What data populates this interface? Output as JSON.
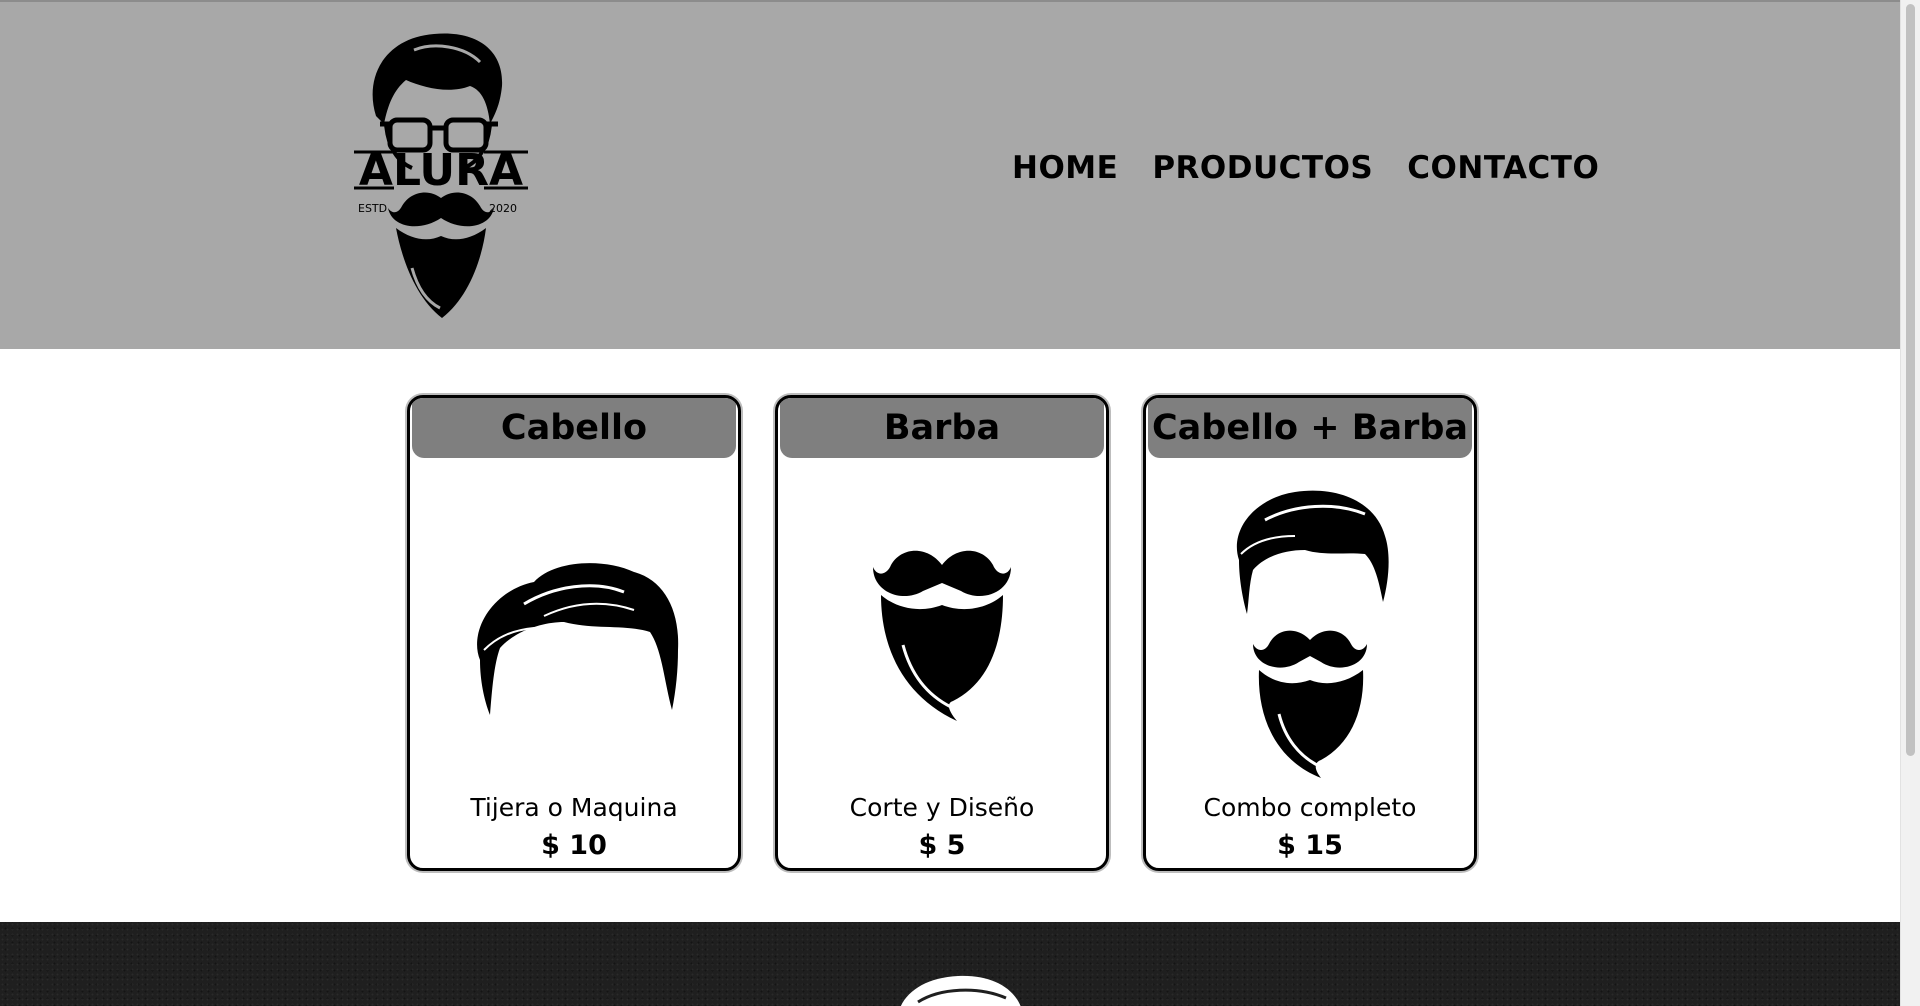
{
  "header": {
    "logo": {
      "brand": "ALURA",
      "left_text": "ESTD",
      "right_text": "2020",
      "icon": "bearded-man-logo"
    },
    "nav": [
      {
        "label": "HOME"
      },
      {
        "label": "PRODUCTOS"
      },
      {
        "label": "CONTACTO"
      }
    ]
  },
  "products": [
    {
      "title": "Cabello",
      "description": "Tijera o Maquina",
      "price": "$ 10",
      "icon": "hair-icon"
    },
    {
      "title": "Barba",
      "description": "Corte y Diseño",
      "price": "$ 5",
      "icon": "beard-icon"
    },
    {
      "title": "Cabello + Barba",
      "description": "Combo completo",
      "price": "$ 15",
      "icon": "hair-and-beard-icon"
    }
  ],
  "colors": {
    "header_bg": "#a8a8a8",
    "card_title_bg": "#7f7f7f",
    "footer_bg": "#1f1f1f",
    "text": "#000000"
  }
}
